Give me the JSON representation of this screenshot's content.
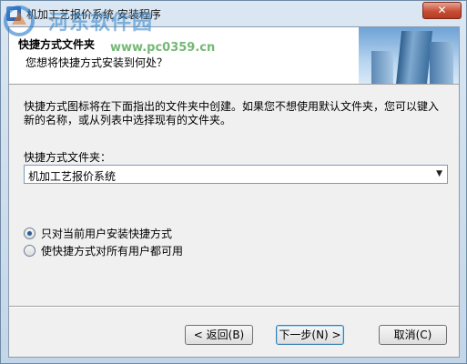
{
  "window": {
    "title": "机加工艺报价系统 安装程序",
    "close_glyph": "✕"
  },
  "watermark": {
    "site_name": "河东软件园",
    "url": "www.pc0359.cn"
  },
  "header": {
    "title": "快捷方式文件夹",
    "subtitle": "您想将快捷方式安装到何处？"
  },
  "body": {
    "description": "快捷方式图标将在下面指出的文件夹中创建。如果您不想使用默认文件夹，您可以键入新的名称，或从列表中选择现有的文件夹。",
    "folder_label": "快捷方式文件夹：",
    "folder_value": "机加工艺报价系统",
    "combo_arrow": "▼"
  },
  "options": {
    "current_user": {
      "label": "只对当前用户安装快捷方式",
      "checked": true
    },
    "all_users": {
      "label": "使快捷方式对所有用户都可用",
      "checked": false
    }
  },
  "buttons": {
    "back": "< 返回(B)",
    "next": "下一步(N) >",
    "cancel": "取消(C)"
  }
}
